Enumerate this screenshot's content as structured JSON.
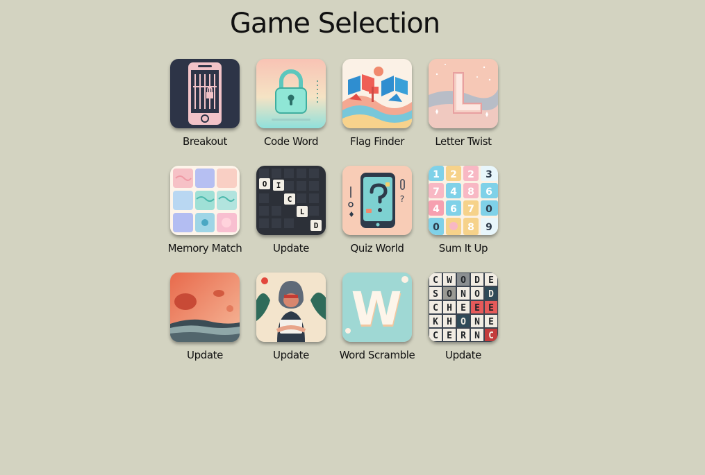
{
  "header": {
    "title": "Game Selection"
  },
  "games": [
    {
      "label": "Breakout",
      "icon": "phone-lock-icon"
    },
    {
      "label": "Code Word",
      "icon": "padlock-icon"
    },
    {
      "label": "Flag Finder",
      "icon": "flags-icon"
    },
    {
      "label": "Letter Twist",
      "icon": "letter-l-icon"
    },
    {
      "label": "Memory Match",
      "icon": "memory-cards-icon"
    },
    {
      "label": "Update",
      "icon": "crossword-tiles-icon",
      "tile_letters": [
        "O",
        "I",
        "C",
        "L",
        "D"
      ]
    },
    {
      "label": "Quiz World",
      "icon": "quiz-tablet-icon"
    },
    {
      "label": "Sum It Up",
      "icon": "number-grid-icon",
      "tile_numbers": [
        "1",
        "2",
        "2",
        "3",
        "7",
        "4",
        "8",
        "6",
        "4",
        "6",
        "7",
        "0",
        "0",
        "8",
        "9"
      ]
    },
    {
      "label": "Update",
      "icon": "abstract-landscape-icon"
    },
    {
      "label": "Update",
      "icon": "hooded-reader-icon"
    },
    {
      "label": "Word Scramble",
      "icon": "letter-w-icon",
      "tile_letter": "W"
    },
    {
      "label": "Update",
      "icon": "word-grid-icon",
      "tile_rows": [
        [
          "C",
          "W",
          "O",
          "D",
          "E"
        ],
        [
          "S",
          "O",
          "N",
          "O",
          "D"
        ],
        [
          "C",
          "H",
          "E",
          "E",
          "E"
        ],
        [
          "K",
          "H",
          "O",
          "N",
          "E"
        ],
        [
          "C",
          "E",
          "R",
          "N",
          "C"
        ]
      ]
    }
  ],
  "colors": {
    "background": "#d3d3c1",
    "text": "#111111"
  }
}
